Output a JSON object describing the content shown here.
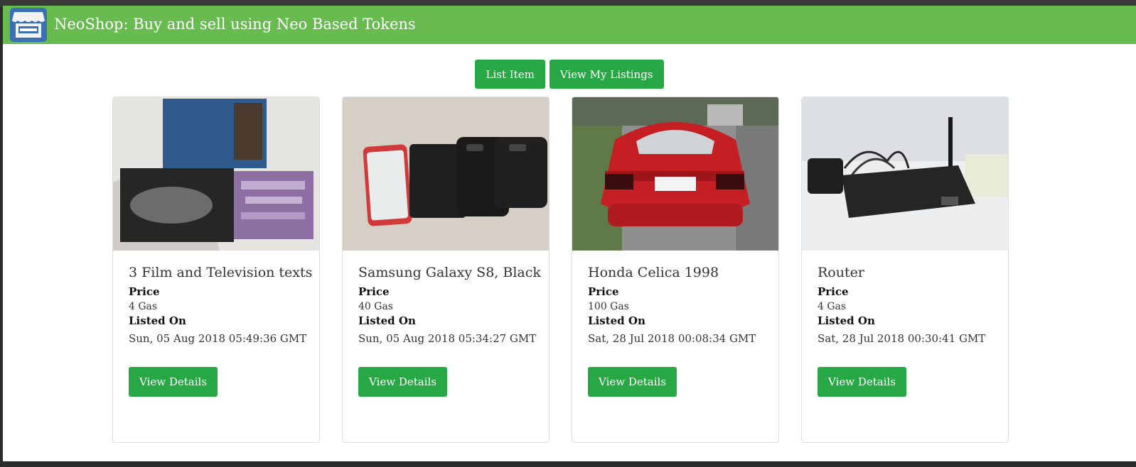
{
  "header": {
    "brand": "NeoShop: Buy and sell using Neo Based Tokens",
    "colors": {
      "navbar": "#68bb4e",
      "button": "#28a745"
    },
    "logo_icon": "storefront-icon"
  },
  "actions": {
    "list_item": "List Item",
    "view_my_listings": "View My Listings"
  },
  "listings": [
    {
      "title": "3 Film and Television texts",
      "price_label": "Price",
      "price": "4 Gas",
      "listed_label": "Listed On",
      "listed_on": "Sun, 05 Aug 2018 05:49:36 GMT",
      "button": "View Details",
      "image": "books-photo"
    },
    {
      "title": "Samsung Galaxy S8, Black",
      "price_label": "Price",
      "price": "40 Gas",
      "listed_label": "Listed On",
      "listed_on": "Sun, 05 Aug 2018 05:34:27 GMT",
      "button": "View Details",
      "image": "phone-photo"
    },
    {
      "title": "Honda Celica 1998",
      "price_label": "Price",
      "price": "100 Gas",
      "listed_label": "Listed On",
      "listed_on": "Sat, 28 Jul 2018 00:08:34 GMT",
      "button": "View Details",
      "image": "car-photo"
    },
    {
      "title": "Router",
      "price_label": "Price",
      "price": "4 Gas",
      "listed_label": "Listed On",
      "listed_on": "Sat, 28 Jul 2018 00:30:41 GMT",
      "button": "View Details",
      "image": "router-photo"
    }
  ]
}
